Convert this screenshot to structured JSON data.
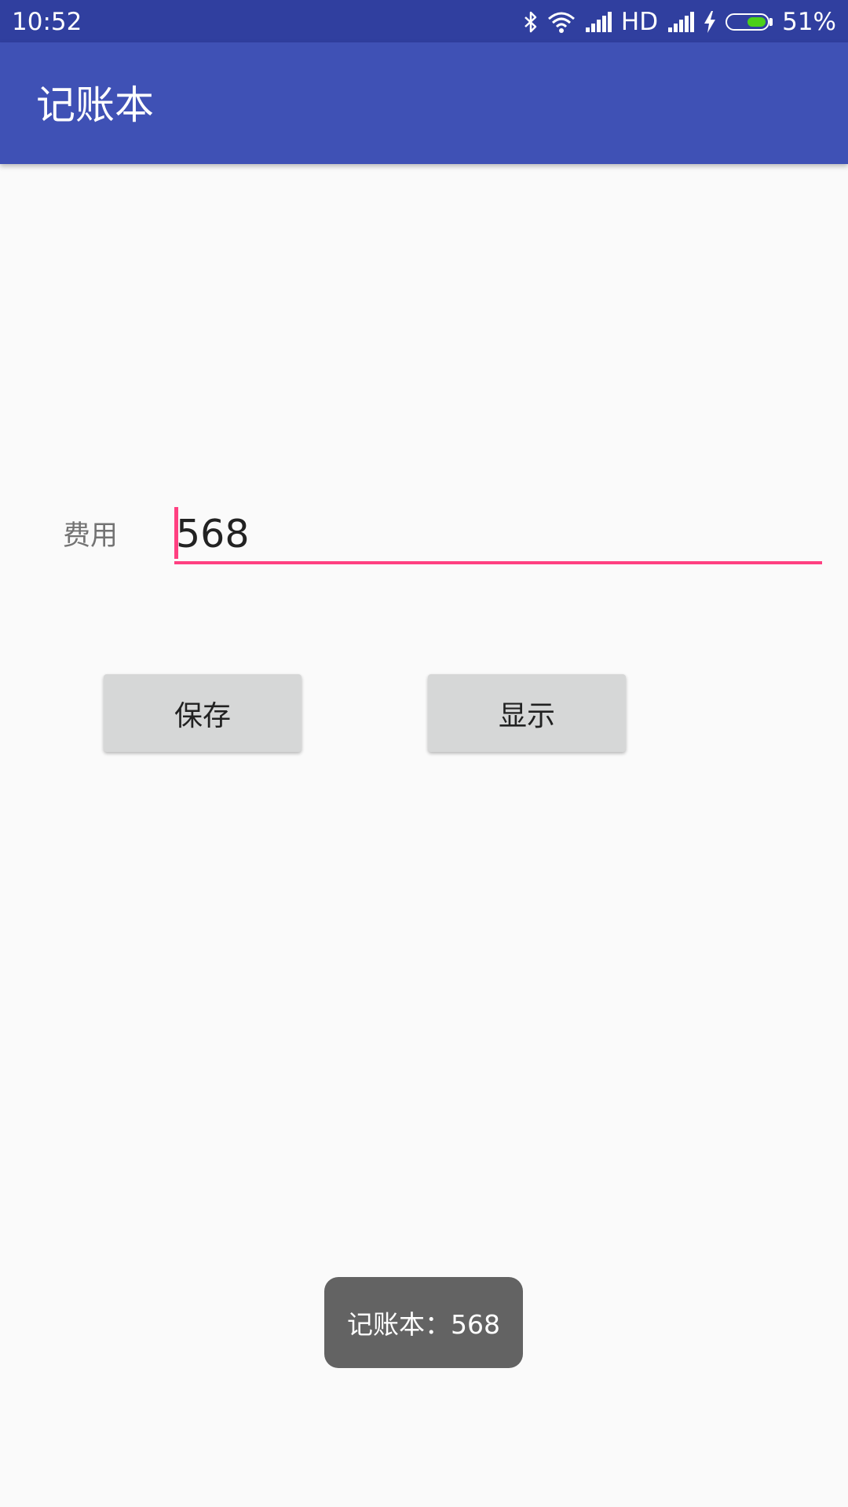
{
  "status_bar": {
    "time": "10:52",
    "network_type": "HD",
    "battery_percent": "51%",
    "battery_level": 0.51,
    "icons": [
      "bluetooth-icon",
      "wifi-icon",
      "signal-icon",
      "signal-icon-2",
      "charging-icon",
      "battery-icon"
    ]
  },
  "app_bar": {
    "title": "记账本",
    "color": "#3f51b5"
  },
  "form": {
    "label": "费用",
    "amount_value": "568",
    "accent_color": "#ff4081"
  },
  "buttons": {
    "save_label": "保存",
    "show_label": "显示"
  },
  "toast": {
    "message": "记账本：568"
  }
}
